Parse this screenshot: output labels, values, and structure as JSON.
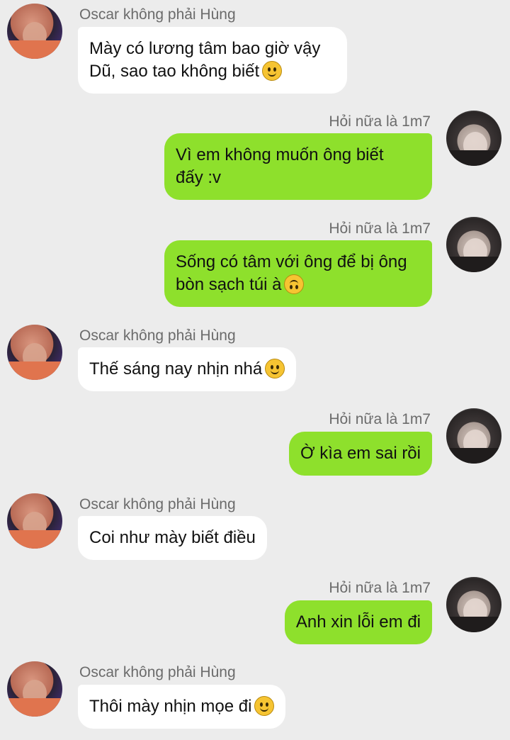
{
  "chat": {
    "messages": [
      {
        "sender": "Oscar không phải Hùng",
        "side": "left",
        "lines": [
          "Mày có lương tâm bao giờ vậy",
          "Dũ, sao tao không biết"
        ],
        "emoji": "slightly-smiling-face-emoji"
      },
      {
        "sender": "Hỏi nữa là 1m7",
        "side": "right",
        "lines": [
          "Vì em không muốn ông biết",
          "đấy :v"
        ],
        "emoji": ""
      },
      {
        "sender": "Hỏi nữa là 1m7",
        "side": "right",
        "lines": [
          "Sống có tâm với ông để bị ông",
          "bòn sạch túi à"
        ],
        "emoji": "upside-down-face-emoji"
      },
      {
        "sender": "Oscar không phải Hùng",
        "side": "left",
        "lines": [
          "Thế sáng nay nhịn nhá"
        ],
        "emoji": "slightly-smiling-face-emoji"
      },
      {
        "sender": "Hỏi nữa là 1m7",
        "side": "right",
        "lines": [
          "Ờ kìa em sai rồi"
        ],
        "emoji": ""
      },
      {
        "sender": "Oscar không phải Hùng",
        "side": "left",
        "lines": [
          "Coi như mày biết điều"
        ],
        "emoji": ""
      },
      {
        "sender": "Hỏi nữa là 1m7",
        "side": "right",
        "lines": [
          "Anh xin lỗi em đi"
        ],
        "emoji": ""
      },
      {
        "sender": "Oscar không phải Hùng",
        "side": "left",
        "lines": [
          "Thôi mày nhịn mọe đi"
        ],
        "emoji": "slightly-smiling-face-emoji"
      }
    ]
  },
  "colors": {
    "background": "#ececec",
    "outgoing_bubble": "#8ee02c",
    "incoming_bubble": "#ffffff",
    "sender_name": "#6b6b6b"
  }
}
